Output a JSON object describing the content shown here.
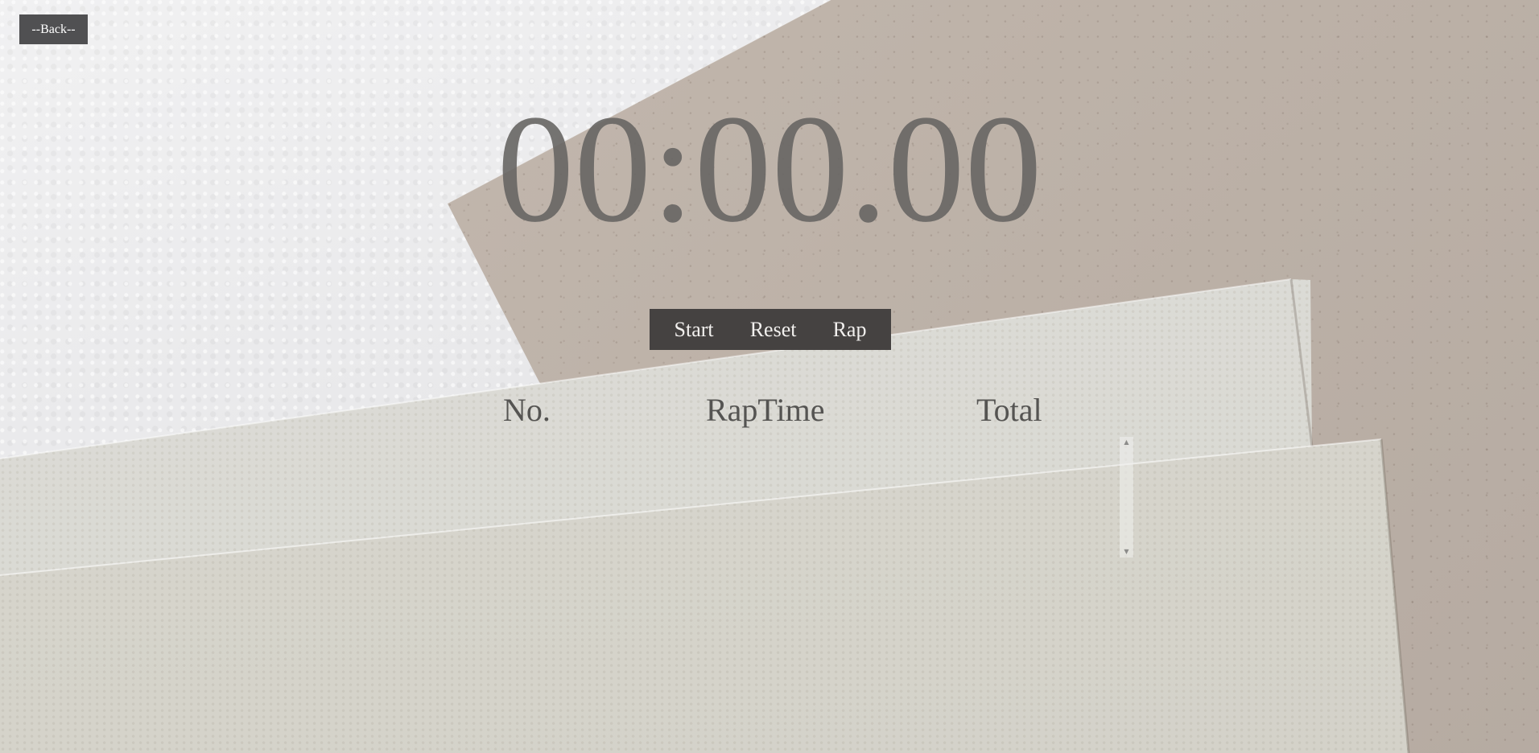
{
  "nav": {
    "back_label": "--Back--"
  },
  "timer": {
    "display": "00:00.00"
  },
  "controls": {
    "start_label": "Start",
    "reset_label": "Reset",
    "rap_label": "Rap"
  },
  "laps_table": {
    "headers": {
      "no": "No.",
      "rap_time": "RapTime",
      "total": "Total"
    },
    "rows": []
  },
  "scrollbar": {
    "up_icon": "triangle-up-icon",
    "down_icon": "triangle-down-icon"
  },
  "colors": {
    "button_bg": "#454241",
    "back_bg": "#505052",
    "timer_text": "#686664",
    "header_text": "#555452"
  }
}
